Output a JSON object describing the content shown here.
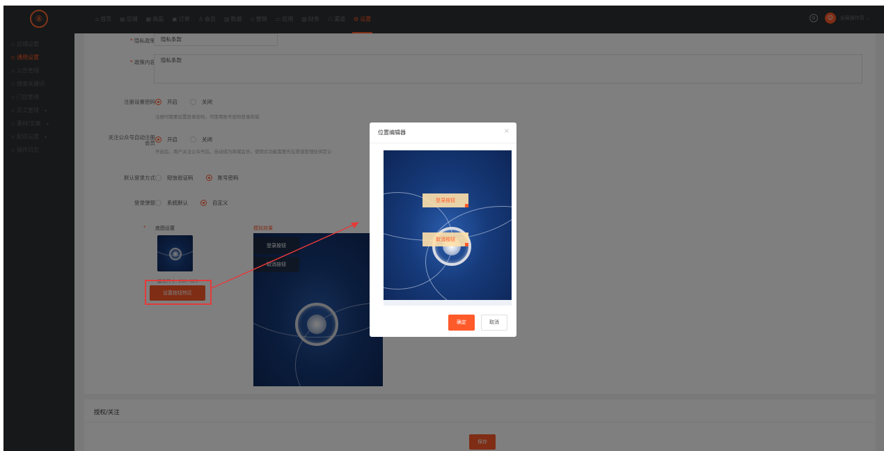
{
  "brand": {
    "logo_glyph": "⑧",
    "accent": "#ff5a2a"
  },
  "topnav": {
    "items": [
      {
        "icon": "⌂",
        "label": "首页"
      },
      {
        "icon": "▤",
        "label": "店铺"
      },
      {
        "icon": "▦",
        "label": "商品"
      },
      {
        "icon": "▣",
        "label": "订单"
      },
      {
        "icon": "♙",
        "label": "会员"
      },
      {
        "icon": "▥",
        "label": "数据"
      },
      {
        "icon": "◇",
        "label": "营销"
      },
      {
        "icon": "▭",
        "label": "应用"
      },
      {
        "icon": "▧",
        "label": "财务"
      },
      {
        "icon": "☖",
        "label": "渠道"
      },
      {
        "icon": "⚙",
        "label": "设置"
      }
    ],
    "user_name": "全局操作员 ⌄",
    "bell_glyph": "⊙",
    "avatar_glyph": "☺"
  },
  "sidebar": {
    "items": [
      {
        "label": "店铺设置"
      },
      {
        "label": "通用设置"
      },
      {
        "label": "公告管理"
      },
      {
        "label": "搜索关键词"
      },
      {
        "label": "门店管理"
      },
      {
        "label": "员工管理",
        "caret": "▾"
      },
      {
        "label": "素材/文案",
        "caret": "▾"
      },
      {
        "label": "配送设置",
        "caret": "▾"
      },
      {
        "label": "操作日志"
      }
    ]
  },
  "form": {
    "privacy_policy_label": "隐私政策",
    "privacy_policy_value": "隐私条款",
    "policy_content_label": "政策内容",
    "policy_content_value": "隐私条款",
    "reg_password_label": "注册设置密码",
    "opt_on": "开启",
    "opt_off": "关闭",
    "reg_password_hint": "注册时需要设置登录密码，可使用账号密码登录商城",
    "follow_label_line1": "关注公众号自动注册",
    "follow_label_line2": "会员",
    "follow_hint": "开启后，用户关注公众号后，自动成为商城会员，使用此功能需要先在渠道管理处绑定公",
    "login_method_label": "默认登录方式",
    "login_sms": "短信验证码",
    "login_account": "账号密码",
    "login_popup_label": "登录弹窗",
    "popup_default": "系统默认",
    "popup_custom": "自定义",
    "bg_setting_label": "底图设置",
    "preview_label": "模拟效果",
    "size_hint": "建议尺寸: 280*325",
    "set_hotspot_btn": "设置按钮热区",
    "preview_login_btn": "登录按钮",
    "preview_cancel_btn": "取消按钮"
  },
  "bottom": {
    "section_title": "授权/关注",
    "save_label": "保存"
  },
  "modal": {
    "title": "位置编辑器",
    "close_glyph": "×",
    "hotspot_login": "登录按钮",
    "hotspot_cancel": "取消按钮",
    "ok_label": "确定",
    "cancel_label": "取消"
  }
}
